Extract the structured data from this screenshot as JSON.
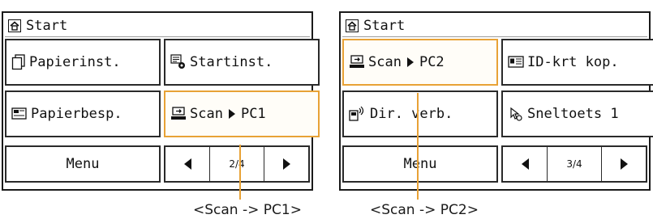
{
  "panels": [
    {
      "title": "Start",
      "tiles": [
        {
          "label": "Papierinst."
        },
        {
          "label": "Startinst."
        },
        {
          "label": "Papierbesp."
        },
        {
          "label": "Scan",
          "suffix": "PC1",
          "selected": true
        }
      ],
      "menu_label": "Menu",
      "page": "2/4"
    },
    {
      "title": "Start",
      "tiles": [
        {
          "label": "Scan",
          "suffix": "PC2",
          "selected": true
        },
        {
          "label": "ID-krt kop."
        },
        {
          "label": "Dir. verb."
        },
        {
          "label": "Sneltoets 1"
        }
      ],
      "menu_label": "Menu",
      "page": "3/4"
    }
  ],
  "callouts": [
    {
      "label": "<Scan -> PC1>"
    },
    {
      "label": "<Scan -> PC2>"
    }
  ],
  "colors": {
    "highlight": "#e8a236",
    "frame": "#1a1a1a"
  },
  "icons": [
    "home-icon",
    "paper-settings-icon",
    "startup-settings-icon",
    "paper-saving-icon",
    "scan-to-pc-icon",
    "id-card-copy-icon",
    "direct-connection-icon",
    "shortcut-icon",
    "arrow-left-icon",
    "arrow-right-icon"
  ]
}
